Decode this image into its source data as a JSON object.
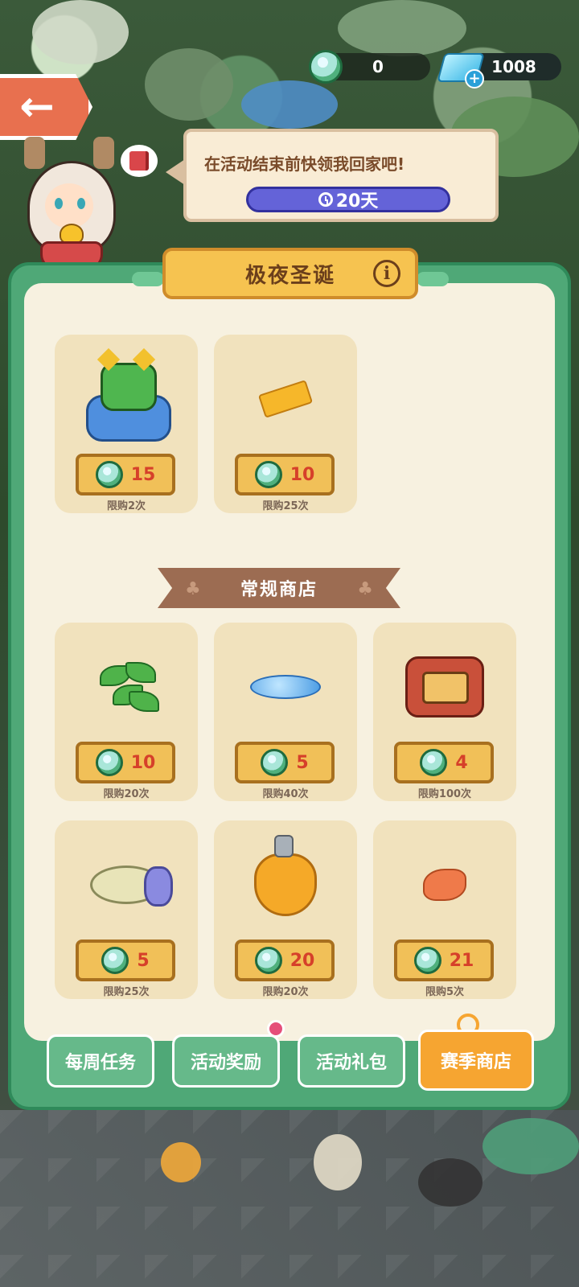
{
  "currency": {
    "seeds": "0",
    "gems": "1008"
  },
  "event": {
    "speech": "在活动结束前快领我回家吧!",
    "timer": "20天"
  },
  "panel": {
    "title": "极夜圣诞",
    "info_symbol": "i"
  },
  "featured_items": [
    {
      "name": "robot-pillow",
      "price": "15",
      "limit": "限购2次"
    },
    {
      "name": "ticket",
      "price": "10",
      "limit": "限购25次"
    }
  ],
  "regular_shop": {
    "title": "常规商店",
    "items": [
      {
        "name": "leaf-plant",
        "price": "10",
        "limit": "限购20次"
      },
      {
        "name": "water-puddle",
        "price": "5",
        "limit": "限购40次"
      },
      {
        "name": "radio",
        "price": "4",
        "limit": "限购100次"
      },
      {
        "name": "cream-jar",
        "price": "5",
        "limit": "限购25次"
      },
      {
        "name": "windup-duck",
        "price": "20",
        "limit": "限购20次"
      },
      {
        "name": "fish-snack",
        "price": "21",
        "limit": "限购5次"
      }
    ]
  },
  "tabs": [
    {
      "label": "每周任务"
    },
    {
      "label": "活动奖励"
    },
    {
      "label": "活动礼包"
    },
    {
      "label": "赛季商店"
    }
  ],
  "colors": {
    "panel_green": "#4fa877",
    "price_red": "#d6402a",
    "active_tab": "#f6a531",
    "timer_purple": "#6463d8"
  }
}
